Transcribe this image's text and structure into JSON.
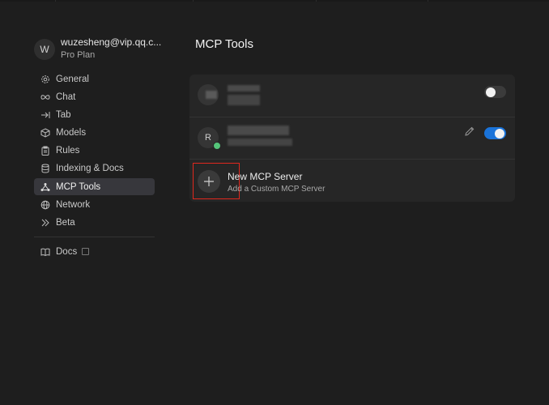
{
  "account": {
    "avatar_initial": "W",
    "email": "wuzesheng@vip.qq.c...",
    "plan": "Pro Plan"
  },
  "sidebar": {
    "items": [
      {
        "label": "General",
        "icon": "gear-icon",
        "active": false
      },
      {
        "label": "Chat",
        "icon": "infinity-icon",
        "active": false
      },
      {
        "label": "Tab",
        "icon": "tab-arrow-icon",
        "active": false
      },
      {
        "label": "Models",
        "icon": "cube-icon",
        "active": false
      },
      {
        "label": "Rules",
        "icon": "clipboard-icon",
        "active": false
      },
      {
        "label": "Indexing & Docs",
        "icon": "database-icon",
        "active": false
      },
      {
        "label": "MCP Tools",
        "icon": "nodes-icon",
        "active": true
      },
      {
        "label": "Network",
        "icon": "globe-icon",
        "active": false
      },
      {
        "label": "Beta",
        "icon": "double-chevron-icon",
        "active": false
      }
    ],
    "docs_label": "Docs"
  },
  "main": {
    "title": "MCP Tools",
    "servers": [
      {
        "avatar_initial": "",
        "enabled": false,
        "editable": false
      },
      {
        "avatar_initial": "R",
        "enabled": true,
        "editable": true,
        "status": "online"
      }
    ],
    "new_server": {
      "title": "New MCP Server",
      "subtitle": "Add a Custom MCP Server"
    }
  },
  "colors": {
    "background": "#1e1e1e",
    "panel": "#262626",
    "active_nav": "#37373c",
    "toggle_on": "#1a73d9",
    "status_online": "#55c57a",
    "highlight": "#e0281e"
  }
}
